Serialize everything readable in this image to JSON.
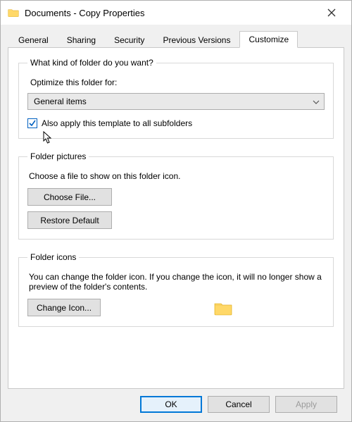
{
  "window": {
    "title": "Documents - Copy Properties"
  },
  "tabs": {
    "general": {
      "label": "General"
    },
    "sharing": {
      "label": "Sharing"
    },
    "security": {
      "label": "Security"
    },
    "previous": {
      "label": "Previous Versions"
    },
    "customize": {
      "label": "Customize"
    }
  },
  "group_kind": {
    "legend": "What kind of folder do you want?",
    "optimize_label": "Optimize this folder for:",
    "combo_value": "General items",
    "apply_subfolders_label": "Also apply this template to all subfolders",
    "apply_subfolders_checked": true
  },
  "group_pictures": {
    "legend": "Folder pictures",
    "caption": "Choose a file to show on this folder icon.",
    "choose_file": "Choose File...",
    "restore_default": "Restore Default"
  },
  "group_icons": {
    "legend": "Folder icons",
    "caption": "You can change the folder icon. If you change the icon, it will no longer show a preview of the folder's contents.",
    "change_icon": "Change Icon..."
  },
  "buttons": {
    "ok": "OK",
    "cancel": "Cancel",
    "apply": "Apply"
  }
}
